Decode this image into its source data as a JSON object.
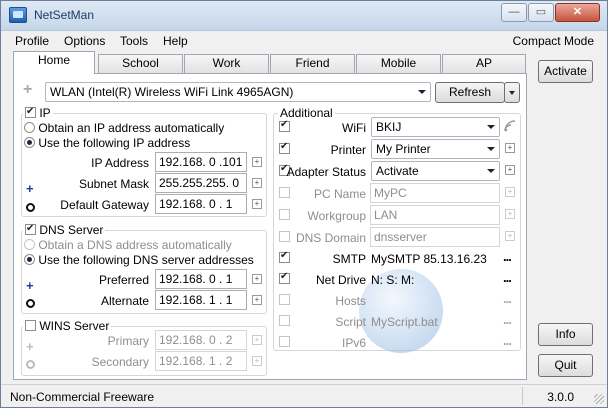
{
  "window": {
    "title": "NetSetMan",
    "minimize": "—",
    "maximize": "▭",
    "close": "✕"
  },
  "menu": {
    "items": [
      "Profile",
      "Options",
      "Tools",
      "Help"
    ],
    "compact_mode": "Compact Mode"
  },
  "tabs": [
    "Home",
    "School",
    "Work",
    "Friend",
    "Mobile",
    "AP"
  ],
  "adapter": {
    "value": "WLAN (Intel(R) Wireless WiFi Link 4965AGN)",
    "refresh_label": "Refresh"
  },
  "ip": {
    "group_label": "IP",
    "auto_label": "Obtain an IP address automatically",
    "manual_label": "Use the following IP address",
    "ip_label": "IP Address",
    "ip_value": "192.168.  0  .101",
    "mask_label": "Subnet Mask",
    "mask_value": "255.255.255.  0",
    "gateway_label": "Default Gateway",
    "gateway_value": "192.168.  0  .  1"
  },
  "dns": {
    "group_label": "DNS Server",
    "auto_label": "Obtain a DNS address automatically",
    "manual_label": "Use the following DNS server addresses",
    "preferred_label": "Preferred",
    "preferred_value": "192.168.  0  .  1",
    "alternate_label": "Alternate",
    "alternate_value": "192.168.  1  .  1"
  },
  "wins": {
    "group_label": "WINS Server",
    "primary_label": "Primary",
    "primary_value": "192.168.  0  .  2",
    "secondary_label": "Secondary",
    "secondary_value": "192.168.  1  .  2"
  },
  "additional": {
    "group_label": "Additional",
    "wifi_label": "WiFi",
    "wifi_value": "BKIJ",
    "printer_label": "Printer",
    "printer_value": "My Printer",
    "adapter_status_label": "Adapter Status",
    "adapter_status_value": "Activate",
    "pc_name_label": "PC Name",
    "pc_name_value": "MyPC",
    "workgroup_label": "Workgroup",
    "workgroup_value": "LAN",
    "dns_domain_label": "DNS Domain",
    "dns_domain_value": "dnsserver",
    "smtp_label": "SMTP",
    "smtp_value": "MySMTP 85.13.16.23",
    "net_drive_label": "Net Drive",
    "net_drive_value": "N: S: M:",
    "hosts_label": "Hosts",
    "script_label": "Script",
    "script_value": "MyScript.bat",
    "ipv6_label": "IPv6",
    "dots": "..."
  },
  "side_buttons": {
    "activate": "Activate",
    "info": "Info",
    "quit": "Quit"
  },
  "status": {
    "left": "Non-Commercial Freeware",
    "right": "3.0.0"
  }
}
